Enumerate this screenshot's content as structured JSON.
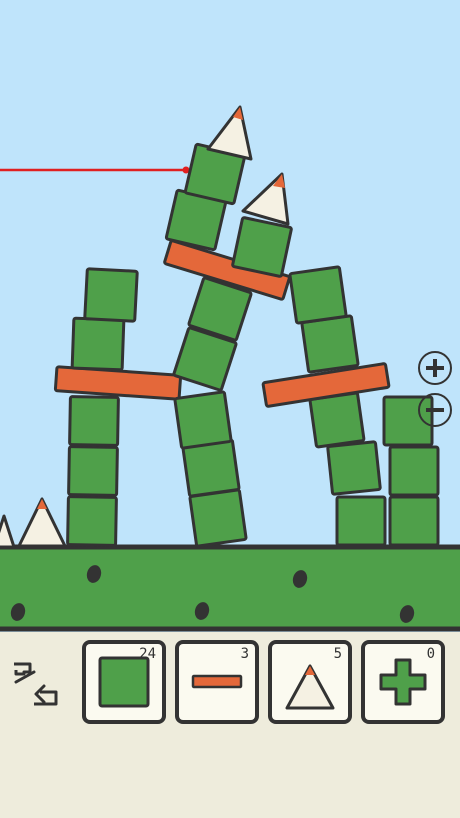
{
  "colors": {
    "sky": "#bfe4fb",
    "block_green": "#4fa04a",
    "plank_orange": "#e4683a",
    "outline": "#333333",
    "grass": "#4fa04a",
    "toolbar_bg": "#eeecdc",
    "height_line": "#e02020"
  },
  "toolbar": {
    "undo_icon": "undo-arrow-icon",
    "tools": [
      {
        "name": "square-block",
        "count": "24"
      },
      {
        "name": "plank",
        "count": "3"
      },
      {
        "name": "triangle",
        "count": "5"
      },
      {
        "name": "cross",
        "count": "0"
      }
    ]
  },
  "zoom": {
    "in_icon": "plus-circle-icon",
    "out_icon": "minus-circle-icon"
  }
}
